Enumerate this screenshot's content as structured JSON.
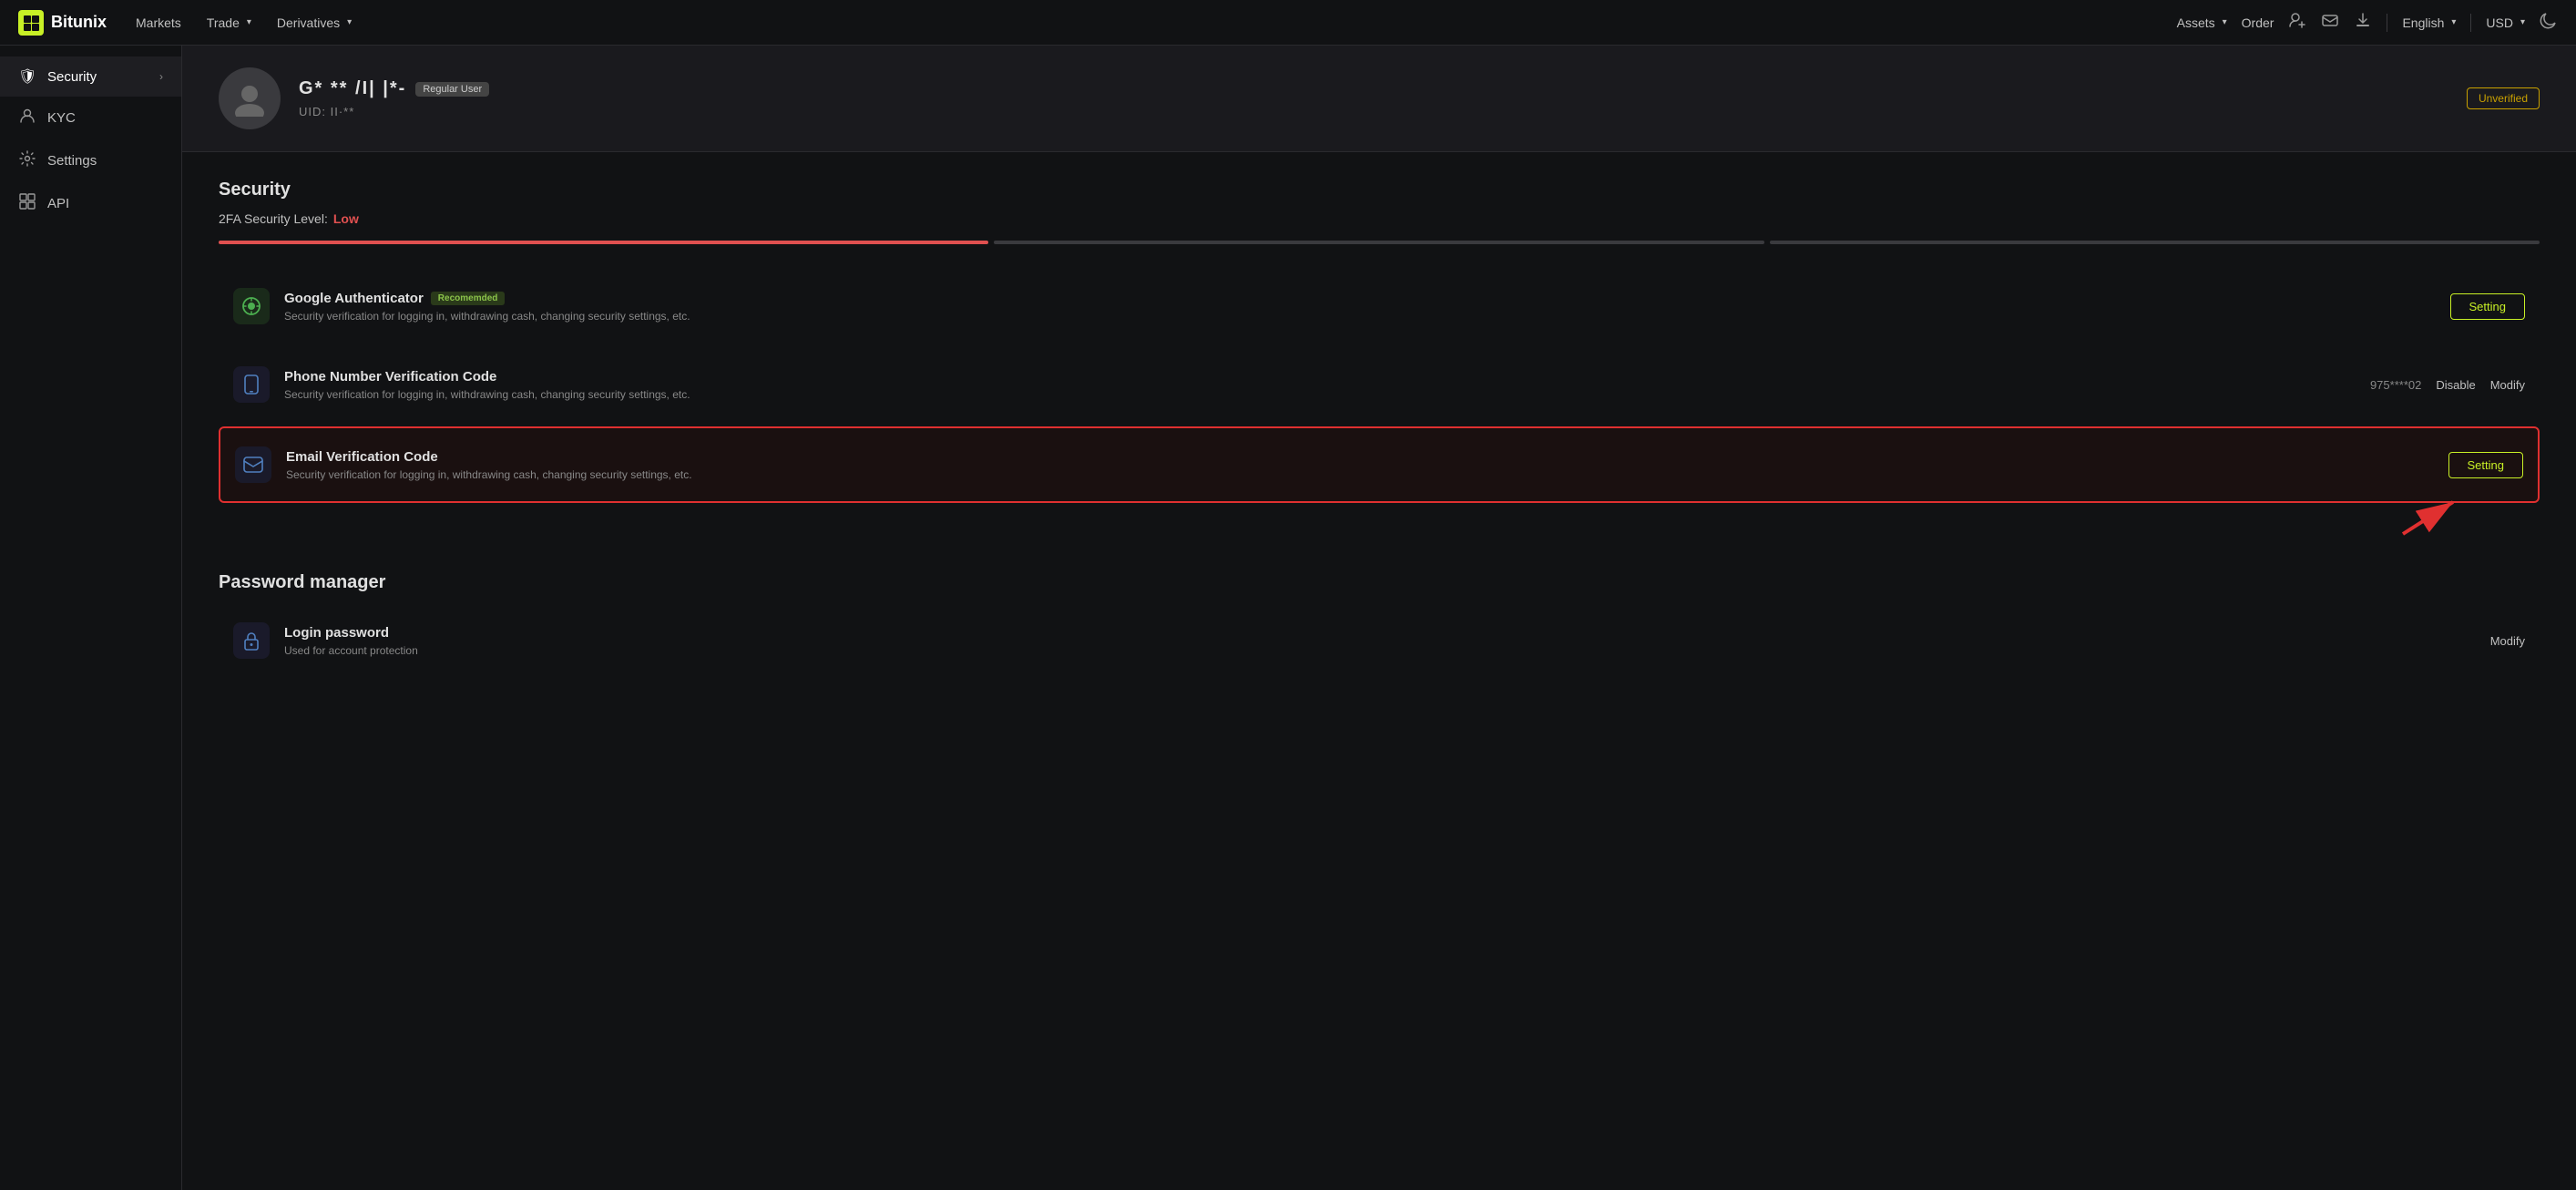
{
  "header": {
    "logo_text": "Bitunix",
    "logo_icon": "B",
    "nav": [
      {
        "label": "Markets",
        "has_dropdown": false
      },
      {
        "label": "Trade",
        "has_dropdown": true
      },
      {
        "label": "Derivatives",
        "has_dropdown": true
      }
    ],
    "right": [
      {
        "label": "Assets",
        "has_dropdown": true
      },
      {
        "label": "Order",
        "has_dropdown": false
      },
      {
        "label": "English",
        "has_dropdown": true
      },
      {
        "label": "USD",
        "has_dropdown": true
      }
    ],
    "icons": [
      "user-add",
      "mail",
      "download",
      "moon"
    ]
  },
  "sidebar": {
    "items": [
      {
        "id": "security",
        "label": "Security",
        "icon": "🛡",
        "active": true,
        "has_arrow": true
      },
      {
        "id": "kyc",
        "label": "KYC",
        "icon": "👤",
        "active": false,
        "has_arrow": false
      },
      {
        "id": "settings",
        "label": "Settings",
        "icon": "⚙",
        "active": false,
        "has_arrow": false
      },
      {
        "id": "api",
        "label": "API",
        "icon": "⊞",
        "active": false,
        "has_arrow": false
      }
    ]
  },
  "profile": {
    "avatar_placeholder": "👤",
    "username_masked": "G* ** /I| |*-",
    "user_type": "Regular User",
    "uid_label": "UID:",
    "uid_masked": "II·**",
    "status": "Unverified"
  },
  "security": {
    "section_title": "Security",
    "level_label": "2FA Security Level:",
    "level_value": "Low",
    "progress_segments": [
      {
        "active": true
      },
      {
        "active": false
      },
      {
        "active": false
      }
    ],
    "items": [
      {
        "id": "google-auth",
        "icon": "🔵",
        "icon_type": "ga",
        "title": "Google Authenticator",
        "badge": "Recomemded",
        "description": "Security verification for logging in, withdrawing cash, changing security settings, etc.",
        "action": "Setting",
        "phone": null,
        "highlighted": false
      },
      {
        "id": "phone-verify",
        "icon": "📱",
        "icon_type": "phone",
        "title": "Phone Number Verification Code",
        "badge": null,
        "description": "Security verification for logging in, withdrawing cash, changing security settings, etc.",
        "phone": "975****02",
        "action_disable": "Disable",
        "action_modify": "Modify",
        "highlighted": false
      },
      {
        "id": "email-verify",
        "icon": "✉",
        "icon_type": "email",
        "title": "Email Verification Code",
        "badge": null,
        "description": "Security verification for logging in, withdrawing cash, changing security settings, etc.",
        "action": "Setting",
        "phone": null,
        "highlighted": true
      }
    ]
  },
  "password_manager": {
    "section_title": "Password manager",
    "items": [
      {
        "id": "login-password",
        "icon": "🔒",
        "icon_type": "lock",
        "title": "Login password",
        "description": "Used for account protection",
        "action_modify": "Modify"
      }
    ]
  }
}
